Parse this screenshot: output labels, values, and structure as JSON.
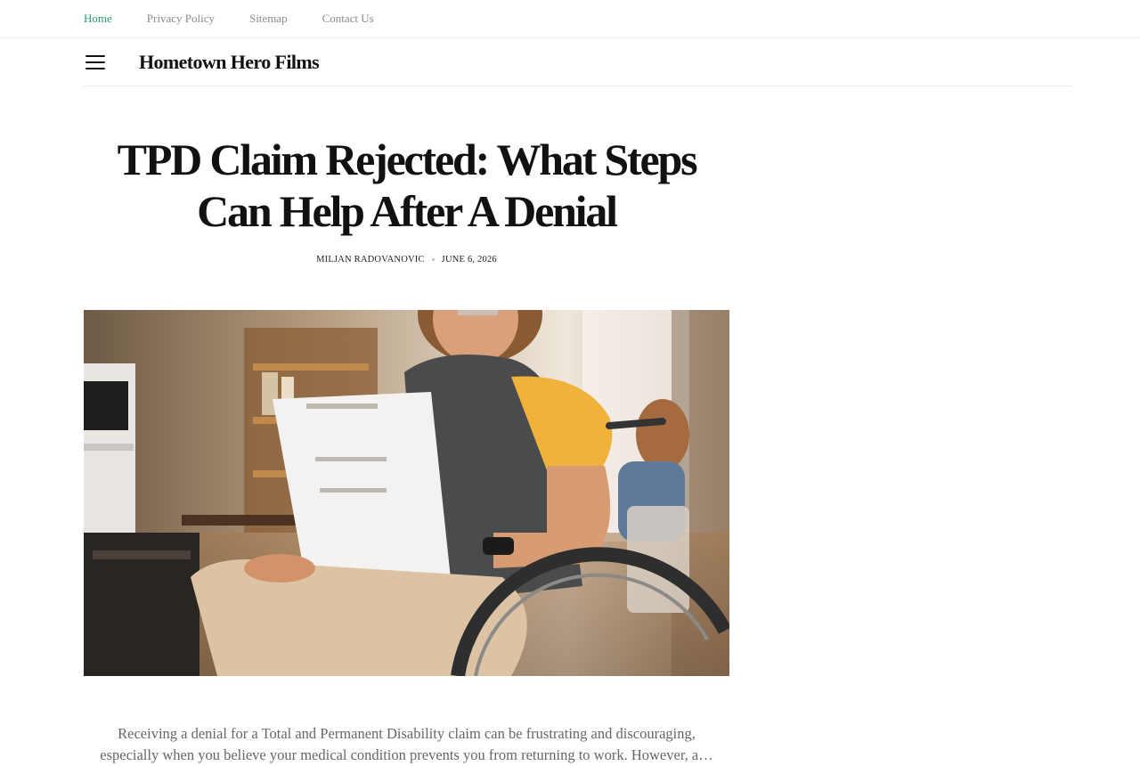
{
  "topnav": {
    "items": [
      "Home",
      "Privacy Policy",
      "Sitemap",
      "Contact Us"
    ]
  },
  "header": {
    "menu_icon": "hamburger-menu-icon",
    "site_title": "Hometown Hero Films"
  },
  "article": {
    "title": "TPD Claim Rejected: What Steps Can Help After A Denial",
    "author": "MILJAN RADOVANOVIC",
    "date": "JUNE 6, 2026",
    "intro_line1": "Receiving a denial for a Total and Permanent Disability claim can be frustrating and discouraging,",
    "intro_line2": "especially when you believe your medical condition prevents you from returning to work. However, a…"
  },
  "colors": {
    "accent": "#2a9d63",
    "nav_text": "#8a8a8a",
    "body_text": "#666666"
  }
}
